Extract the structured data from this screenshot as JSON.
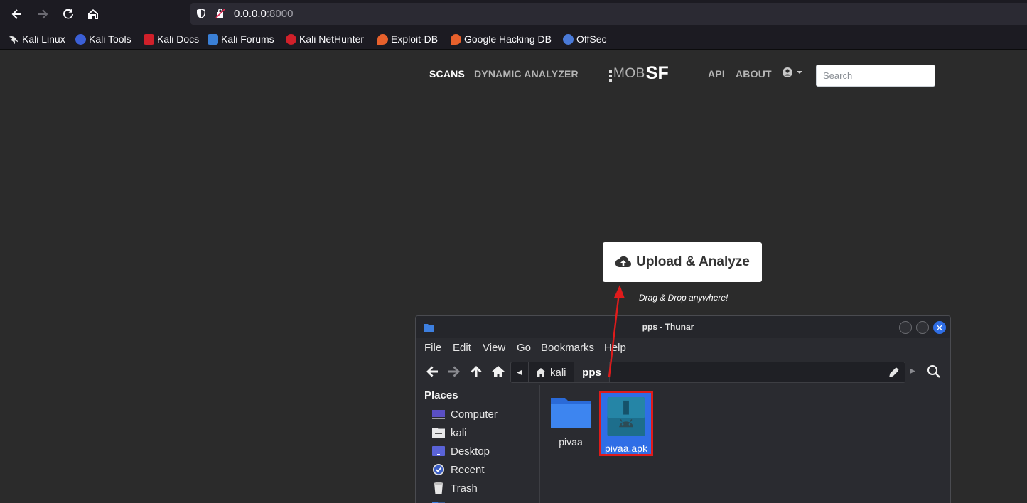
{
  "browser": {
    "url_host": "0.0.0.0",
    "url_port": ":8000",
    "bookmarks": [
      {
        "label": "Kali Linux",
        "icon": "kali-dragon-icon",
        "color": "#ffffff"
      },
      {
        "label": "Kali Tools",
        "icon": "kali-tools-icon",
        "color": "#3b5fd6"
      },
      {
        "label": "Kali Docs",
        "icon": "kali-docs-icon",
        "color": "#d0202a"
      },
      {
        "label": "Kali Forums",
        "icon": "kali-forums-icon",
        "color": "#3a7fd6"
      },
      {
        "label": "Kali NetHunter",
        "icon": "kali-nethunter-icon",
        "color": "#d0202a"
      },
      {
        "label": "Exploit-DB",
        "icon": "exploit-db-icon",
        "color": "#e8612c"
      },
      {
        "label": "Google Hacking DB",
        "icon": "ghdb-icon",
        "color": "#e8612c"
      },
      {
        "label": "OffSec",
        "icon": "offsec-icon",
        "color": "#4a7ad8"
      }
    ]
  },
  "mobsf": {
    "nav": {
      "scans": "SCANS",
      "dynamic_analyzer": "DYNAMIC ANALYZER",
      "api": "API",
      "about": "ABOUT"
    },
    "logo": {
      "mob": "MOB",
      "sf": "SF"
    },
    "search_placeholder": "Search",
    "upload_label": "Upload & Analyze",
    "drag_hint": "Drag & Drop anywhere!"
  },
  "thunar": {
    "title": "pps - Thunar",
    "menu": [
      "File",
      "Edit",
      "View",
      "Go",
      "Bookmarks",
      "Help"
    ],
    "breadcrumbs": [
      "kali",
      "pps"
    ],
    "places_heading": "Places",
    "places": [
      "Computer",
      "kali",
      "Desktop",
      "Recent",
      "Trash"
    ],
    "files": [
      {
        "name": "pivaa",
        "type": "folder",
        "selected": false
      },
      {
        "name": "pivaa.apk",
        "type": "apk",
        "selected": true
      }
    ]
  },
  "colors": {
    "page_bg": "#2b2b2b",
    "accent_blue": "#2f6ee6",
    "annotation_red": "#e01b1b"
  }
}
